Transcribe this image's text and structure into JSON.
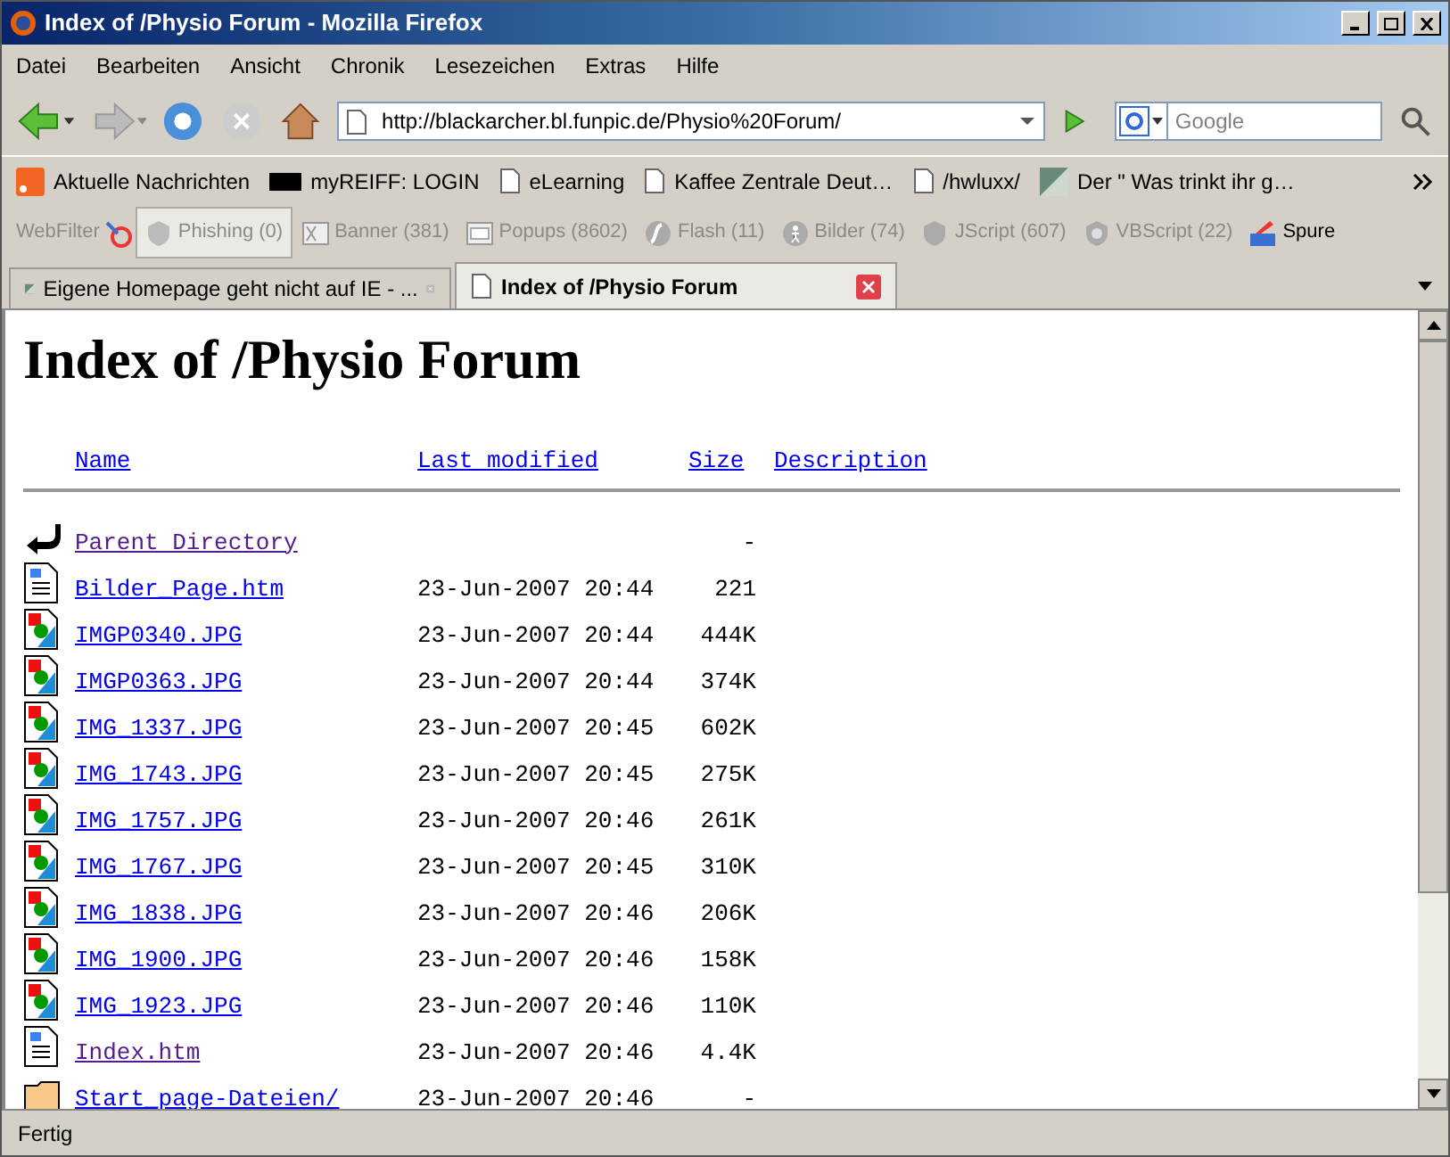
{
  "window": {
    "title": "Index of /Physio Forum - Mozilla Firefox"
  },
  "menu": [
    "Datei",
    "Bearbeiten",
    "Ansicht",
    "Chronik",
    "Lesezeichen",
    "Extras",
    "Hilfe"
  ],
  "address": {
    "value": "http://blackarcher.bl.funpic.de/Physio%20Forum/"
  },
  "search": {
    "placeholder": "Google"
  },
  "bookmarks": [
    {
      "kind": "rss",
      "label": "Aktuelle Nachrichten"
    },
    {
      "kind": "my",
      "label": "myREIFF: LOGIN"
    },
    {
      "kind": "page",
      "label": "eLearning"
    },
    {
      "kind": "page",
      "label": "Kaffee Zentrale Deut…"
    },
    {
      "kind": "page",
      "label": "/hwluxx/"
    },
    {
      "kind": "site",
      "label": "Der \" Was trinkt ihr g…"
    }
  ],
  "webfilter": {
    "label": "WebFilter",
    "items": [
      {
        "kind": "phishing",
        "label": "Phishing (0)",
        "selected": true
      },
      {
        "kind": "banner",
        "label": "Banner (381)",
        "selected": false
      },
      {
        "kind": "popups",
        "label": "Popups (8602)",
        "selected": false
      },
      {
        "kind": "flash",
        "label": "Flash (11)",
        "selected": false
      },
      {
        "kind": "bilder",
        "label": "Bilder (74)",
        "selected": false
      },
      {
        "kind": "shield",
        "label": "JScript (607)",
        "selected": false
      },
      {
        "kind": "vb",
        "label": "VBScript (22)",
        "selected": false
      },
      {
        "kind": "spure",
        "label": "Spure",
        "selected": false
      }
    ]
  },
  "tabs": [
    {
      "label": "Eigene Homepage geht nicht auf IE - ...",
      "selected": false
    },
    {
      "label": "Index of /Physio Forum",
      "selected": true
    }
  ],
  "page": {
    "heading": "Index of /Physio Forum",
    "columns": [
      "Name",
      "Last modified",
      "Size",
      "Description"
    ],
    "rows": [
      {
        "kind": "back",
        "name": "Parent Directory",
        "modified": "",
        "size": "-",
        "visited": true
      },
      {
        "kind": "html",
        "name": "Bilder_Page.htm",
        "modified": "23-Jun-2007 20:44",
        "size": "221",
        "visited": false
      },
      {
        "kind": "image",
        "name": "IMGP0340.JPG",
        "modified": "23-Jun-2007 20:44",
        "size": "444K",
        "visited": false
      },
      {
        "kind": "image",
        "name": "IMGP0363.JPG",
        "modified": "23-Jun-2007 20:44",
        "size": "374K",
        "visited": false
      },
      {
        "kind": "image",
        "name": "IMG_1337.JPG",
        "modified": "23-Jun-2007 20:45",
        "size": "602K",
        "visited": false
      },
      {
        "kind": "image",
        "name": "IMG_1743.JPG",
        "modified": "23-Jun-2007 20:45",
        "size": "275K",
        "visited": false
      },
      {
        "kind": "image",
        "name": "IMG_1757.JPG",
        "modified": "23-Jun-2007 20:46",
        "size": "261K",
        "visited": false
      },
      {
        "kind": "image",
        "name": "IMG_1767.JPG",
        "modified": "23-Jun-2007 20:45",
        "size": "310K",
        "visited": false
      },
      {
        "kind": "image",
        "name": "IMG_1838.JPG",
        "modified": "23-Jun-2007 20:46",
        "size": "206K",
        "visited": false
      },
      {
        "kind": "image",
        "name": "IMG_1900.JPG",
        "modified": "23-Jun-2007 20:46",
        "size": "158K",
        "visited": false
      },
      {
        "kind": "image",
        "name": "IMG_1923.JPG",
        "modified": "23-Jun-2007 20:46",
        "size": "110K",
        "visited": false
      },
      {
        "kind": "html",
        "name": "Index.htm",
        "modified": "23-Jun-2007 20:46",
        "size": "4.4K",
        "visited": true
      },
      {
        "kind": "folder",
        "name": "Start_page-Dateien/",
        "modified": "23-Jun-2007 20:46",
        "size": "-",
        "visited": false
      }
    ]
  },
  "status_bar": "Fertig"
}
